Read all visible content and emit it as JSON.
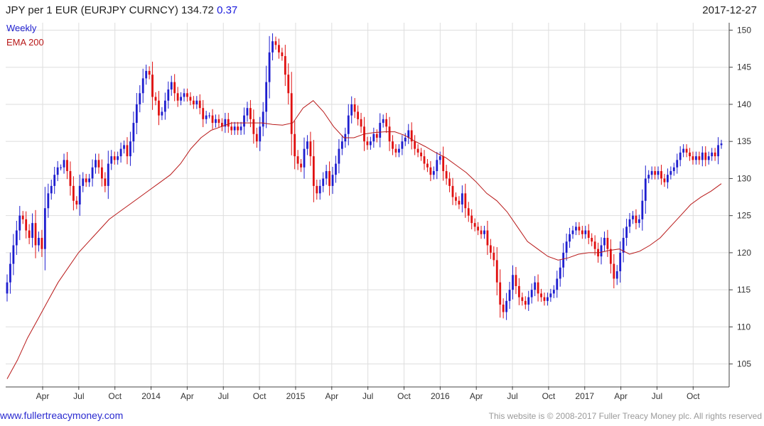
{
  "header": {
    "title": "JPY per 1 EUR (EURJPY CURNCY)",
    "last_price": "134.72",
    "change": "0.37",
    "date": "2017-12-27"
  },
  "legend": {
    "series1": "Weekly",
    "series2": "EMA 200"
  },
  "footer": {
    "website": "www.fullertreacymoney.com",
    "copyright": "This website is © 2008-2017 Fuller Treacy Money plc. All rights reserved"
  },
  "colors": {
    "up": "#1e1ecf",
    "down": "#e01010",
    "ema": "#b81818",
    "grid": "#dedede",
    "axis": "#444444"
  },
  "chart_data": {
    "type": "candlestick",
    "frequency": "Weekly",
    "title": "JPY per 1 EUR (EURJPY CURNCY)",
    "ylim": [
      102,
      151
    ],
    "y_ticks": [
      105,
      110,
      115,
      120,
      125,
      130,
      135,
      140,
      145,
      150
    ],
    "x_ticks": [
      "Apr",
      "Jul",
      "Oct",
      "2014",
      "Apr",
      "Jul",
      "Oct",
      "2015",
      "Apr",
      "Jul",
      "Oct",
      "2016",
      "Apr",
      "Jul",
      "Oct",
      "2017",
      "Apr",
      "Jul",
      "Oct"
    ],
    "grid": true,
    "series": [
      {
        "name": "Weekly",
        "values": [
          116,
          118.5,
          121,
          123,
          125,
          124.5,
          123,
          122,
          124,
          121,
          122,
          120.5,
          126,
          128,
          129,
          130.5,
          131.5,
          131.5,
          132.5,
          131,
          129,
          127,
          126.5,
          129,
          130,
          129.5,
          130,
          131.5,
          132.5,
          131.5,
          130,
          129,
          132,
          133,
          132.5,
          133,
          134,
          134.5,
          133,
          135,
          137.5,
          140,
          141.5,
          143.5,
          144.5,
          144,
          141,
          140.5,
          138.5,
          139,
          140.5,
          142,
          143,
          141.5,
          140.5,
          141,
          141.5,
          141,
          140.5,
          140,
          140.5,
          139.5,
          138,
          138.5,
          138.5,
          137.5,
          138,
          137.5,
          137,
          138,
          137,
          136.5,
          137,
          136.5,
          137,
          138.5,
          139.5,
          138,
          136,
          135,
          137,
          139,
          143,
          147,
          148.5,
          148,
          147,
          146.5,
          144,
          141.5,
          136,
          133,
          132,
          131.5,
          134,
          135,
          133,
          129,
          128,
          129,
          130,
          131,
          129,
          130.5,
          132,
          134,
          135,
          136,
          138.5,
          140,
          139,
          138,
          137,
          135,
          134.5,
          135,
          136,
          135.5,
          137.5,
          138,
          137,
          135,
          134,
          133.5,
          134,
          135,
          135.5,
          136.5,
          135,
          134,
          133.5,
          133,
          132,
          131.5,
          130.5,
          131,
          132.5,
          133,
          131,
          130,
          129,
          127.5,
          127,
          126.5,
          128,
          126,
          125,
          124,
          123.5,
          123,
          122.5,
          123,
          121,
          120,
          119,
          116,
          113,
          112,
          113.5,
          115,
          117,
          115.5,
          114,
          113.5,
          113,
          114,
          115,
          116,
          114.5,
          114,
          113.5,
          114,
          114.5,
          115,
          116.5,
          118,
          120,
          121.5,
          122.5,
          123,
          123.5,
          123,
          122.5,
          123,
          122,
          121.5,
          120.5,
          119.5,
          121,
          122,
          120.5,
          118.5,
          116.5,
          117.5,
          120,
          122,
          123.5,
          124.5,
          125,
          124,
          124.5,
          127,
          130,
          130.5,
          131,
          130.5,
          131,
          130,
          129.5,
          130.5,
          131,
          131.5,
          132.5,
          133.5,
          134,
          133.5,
          133,
          132.5,
          133,
          132.5,
          133.5,
          132.5,
          133,
          133.5,
          133,
          134.5,
          134.72
        ]
      },
      {
        "name": "EMA 200",
        "values": [
          103,
          105.5,
          108.5,
          111,
          113.5,
          116,
          118,
          120,
          121.5,
          123,
          124.5,
          125.5,
          126.5,
          127.5,
          128.5,
          129.5,
          130.5,
          132,
          134,
          135.5,
          136.5,
          137,
          137.5,
          137.5,
          137.5,
          137.5,
          137.3,
          137.2,
          137.5,
          139.5,
          140.5,
          139,
          137,
          135.5,
          135.5,
          136,
          136.2,
          136.3,
          136.3,
          135.8,
          135,
          134.3,
          133.5,
          132.8,
          131.8,
          130.8,
          129.5,
          128,
          127,
          125.5,
          123.5,
          121.5,
          120.5,
          119.5,
          119,
          119.3,
          119.8,
          120,
          120,
          120.3,
          120.5,
          119.8,
          120.2,
          121,
          122,
          123.5,
          125,
          126.5,
          127.5,
          128.3,
          129.3
        ]
      }
    ]
  }
}
